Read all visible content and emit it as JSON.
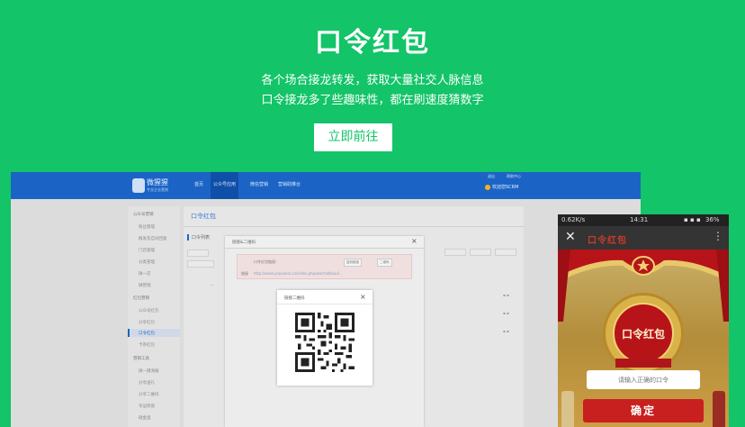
{
  "hero": {
    "title": "口令红包",
    "line1": "各个场合接龙转发，获取大量社交人脉信息",
    "line2": "口令接龙多了些趣味性，都在刷速度猜数字",
    "cta_label": "立即前往"
  },
  "desktop": {
    "logo_text": "微猩猩",
    "logo_sub": "专业企业营销",
    "nav": [
      "首页",
      "公众号应用",
      "微信营销",
      "营销助推台"
    ],
    "active_nav_index": 1,
    "top_right": [
      "退出",
      "帮助中心"
    ],
    "user_name": "欢迎您SCRM",
    "sidebar": {
      "group1": "公众号营销",
      "group1_items": [
        "粉丝管理",
        "群发及自动回复",
        "门店管理",
        "分类管理",
        "微一店",
        "微营销"
      ],
      "group2": "红包营销",
      "group2_items": [
        "公众号红包",
        "分享红包",
        "口令红包",
        "卡券红包"
      ],
      "active_item": "口令红包",
      "group3": "营销工具",
      "group3_items": [
        "微一键海报",
        "分享送礼",
        "分享二维码",
        "幸运转盘",
        "砸金蛋"
      ]
    },
    "content": {
      "title": "口令红包",
      "tab": "口令列表"
    },
    "modal": {
      "title": "链接&二维码",
      "link_label": "口令红包链接：",
      "url_label": "链接",
      "url": "http://www.yaoyaola.cn/index.php/wechat/kouli...",
      "copy_btn": "复制链接",
      "qr_btn": "二维码"
    },
    "qr_modal": {
      "title": "链接二维码"
    }
  },
  "phone": {
    "status_left": "0.62K/s",
    "status_time": "14:31",
    "status_battery": "36%",
    "title": "口令红包",
    "medal_text": "口令红包",
    "input_placeholder": "请输入正确的口令",
    "confirm_label": "确定"
  },
  "colors": {
    "brand_green": "#13c468",
    "desktop_blue": "#1b64c6",
    "red": "#c8201f"
  }
}
